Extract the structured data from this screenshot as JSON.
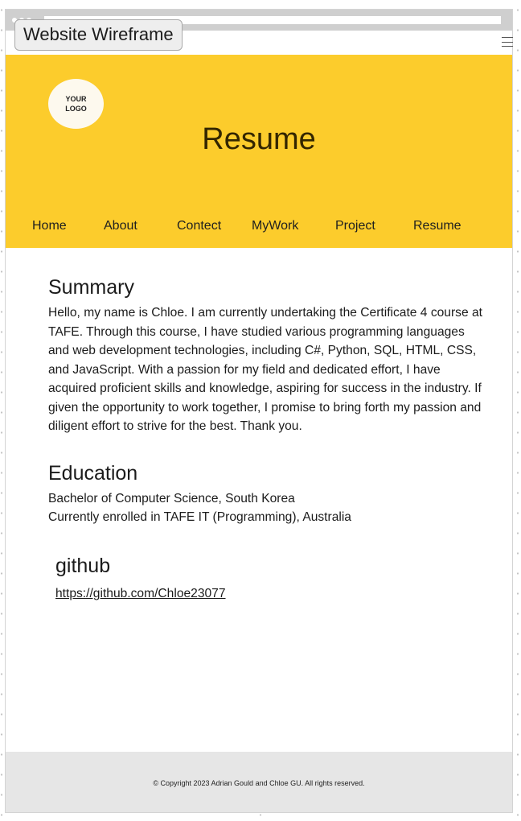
{
  "wireframe": {
    "title": "Website Wireframe",
    "menu_icon": "hamburger-menu-icon"
  },
  "header": {
    "logo_text": "YOUR\nLOGO",
    "title": "Resume",
    "background_color": "#fccc2c"
  },
  "nav": {
    "items": [
      "Home",
      "About",
      "Contect",
      "MyWork",
      "Project",
      "Resume"
    ]
  },
  "summary": {
    "heading": "Summary",
    "text": "Hello, my name is Chloe. I am currently undertaking the Certificate 4 course at TAFE. Through this course, I have studied various programming languages and web development technologies, including C#, Python, SQL, HTML, CSS, and JavaScript. With a passion for my field and dedicated effort, I have acquired proficient skills and knowledge, aspiring for success in the industry. If given the opportunity to work together, I promise to bring forth my passion and diligent effort to strive for the best. Thank you."
  },
  "education": {
    "heading": "Education",
    "lines": [
      "Bachelor of Computer Science,  South Korea",
      "Currently enrolled in TAFE IT (Programming), Australia"
    ]
  },
  "github": {
    "heading": "github",
    "link": "https://github.com/Chloe23077"
  },
  "footer": {
    "copyright": "© Copyright 2023 Adrian Gould and Chloe GU. All rights reserved."
  }
}
